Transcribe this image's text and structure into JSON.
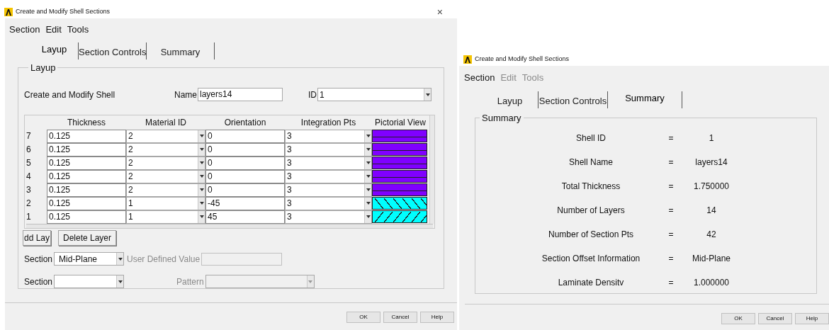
{
  "windows": [
    {
      "kind": "layup",
      "title": "Create and Modify Shell Sections",
      "close": "×",
      "menu": [
        {
          "label": "Section",
          "disabled": false
        },
        {
          "label": "Edit",
          "disabled": false
        },
        {
          "label": "Tools",
          "disabled": false
        }
      ],
      "tabs": [
        {
          "label": "Layup",
          "selected": true
        },
        {
          "label": "Section Controls",
          "selected": false
        },
        {
          "label": "Summary",
          "selected": false
        }
      ],
      "panel": {
        "title": "Layup",
        "heading": "Create and Modify Shell",
        "name_label": "Name",
        "name_value": "layers14",
        "id_label": "ID",
        "id_value": "1",
        "table": {
          "columns": [
            "Thickness",
            "Material ID",
            "Orientation",
            "Integration Pts",
            "Pictorial View"
          ],
          "rows": [
            {
              "number": "7",
              "thickness": "0.125",
              "material_id": "2",
              "orientation": "0",
              "integration_pts": "3",
              "kind": "horizontal",
              "color": "#8000ff"
            },
            {
              "number": "6",
              "thickness": "0.125",
              "material_id": "2",
              "orientation": "0",
              "integration_pts": "3",
              "kind": "horizontal",
              "color": "#8000ff"
            },
            {
              "number": "5",
              "thickness": "0.125",
              "material_id": "2",
              "orientation": "0",
              "integration_pts": "3",
              "kind": "horizontal",
              "color": "#8000ff"
            },
            {
              "number": "4",
              "thickness": "0.125",
              "material_id": "2",
              "orientation": "0",
              "integration_pts": "3",
              "kind": "horizontal",
              "color": "#8000ff"
            },
            {
              "number": "3",
              "thickness": "0.125",
              "material_id": "2",
              "orientation": "0",
              "integration_pts": "3",
              "kind": "horizontal",
              "color": "#8000ff"
            },
            {
              "number": "2",
              "thickness": "0.125",
              "material_id": "1",
              "orientation": "-45",
              "integration_pts": "3",
              "kind": "backslash",
              "color": "#00ffff"
            },
            {
              "number": "1",
              "thickness": "0.125",
              "material_id": "1",
              "orientation": "45",
              "integration_pts": "3",
              "kind": "slash",
              "color": "#00ffff"
            }
          ]
        },
        "layer_buttons": [
          "dd Lay",
          "Delete Layer"
        ],
        "offset": {
          "label": "Section",
          "value": "Mid-Plane",
          "user_label": "User Defined Value",
          "disabled": true
        },
        "section": {
          "label": "Section",
          "pattern_label": "Pattern",
          "disabled": true
        }
      },
      "buttons": [
        "OK",
        "Cancel",
        "Help"
      ]
    },
    {
      "kind": "summary",
      "title": "Create and Modify Shell Sections",
      "menu": [
        {
          "label": "Section",
          "disabled": false
        },
        {
          "label": "Edit",
          "disabled": true
        },
        {
          "label": "Tools",
          "disabled": true
        }
      ],
      "tabs": [
        {
          "label": "Layup",
          "selected": false
        },
        {
          "label": "Section Controls",
          "selected": false
        },
        {
          "label": "Summary",
          "selected": true
        }
      ],
      "panel": {
        "title": "Summary",
        "rows": [
          {
            "label": "Shell ID",
            "sign": "=",
            "value": "1"
          },
          {
            "label": "Shell Name",
            "sign": "=",
            "value": "layers14"
          },
          {
            "label": "Total Thickness",
            "sign": "=",
            "value": "1.750000"
          },
          {
            "label": "Number of Layers",
            "sign": "=",
            "value": "14"
          },
          {
            "label": "Number of Section Pts",
            "sign": "=",
            "value": "42"
          },
          {
            "label": "Section Offset Information",
            "sign": "=",
            "value": "Mid-Plane"
          },
          {
            "label": "Laminate Densitv",
            "sign": "=",
            "value": "1.000000"
          }
        ]
      },
      "buttons": [
        "OK",
        "Cancel",
        "Help"
      ]
    }
  ]
}
